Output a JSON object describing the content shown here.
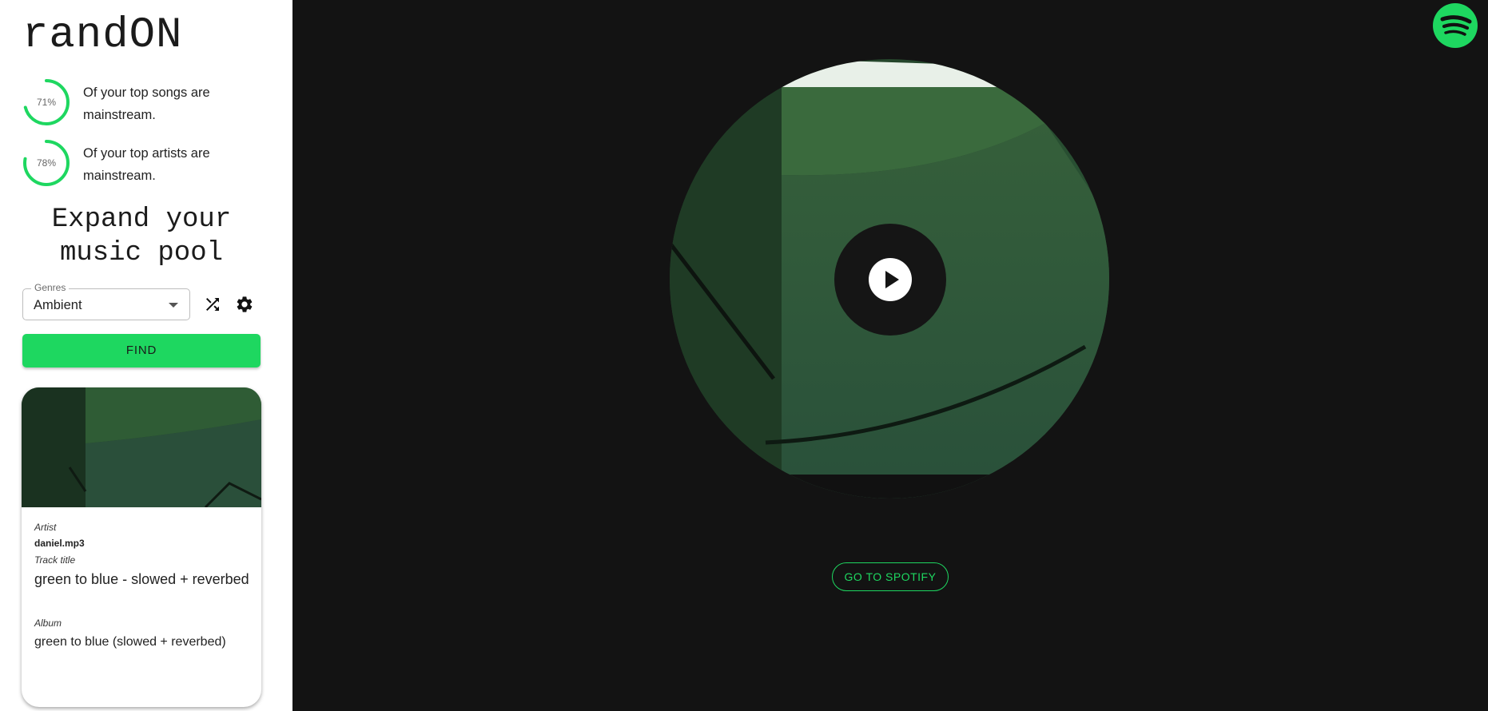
{
  "app": {
    "title": "randON"
  },
  "stats": [
    {
      "percent_label": "71%",
      "percent": 71,
      "text": "Of your top songs are mainstream."
    },
    {
      "percent_label": "78%",
      "percent": 78,
      "text": "Of your top artists are mainstream."
    }
  ],
  "expand_heading": "Expand your music pool",
  "genre_select": {
    "label": "Genres",
    "value": "Ambient"
  },
  "find_button": "FIND",
  "track_card": {
    "artist_label": "Artist",
    "artist": "daniel.mp3",
    "track_label": "Track title",
    "track": "green to blue - slowed + reverbed",
    "album_label": "Album",
    "album": "green to blue (slowed + reverbed)"
  },
  "spotify_button": "GO TO SPOTIFY",
  "icons": {
    "shuffle": "shuffle-icon",
    "settings": "gear-icon",
    "play": "play-icon",
    "spotify": "spotify-logo-icon"
  },
  "colors": {
    "accent": "#1ed760",
    "background": "#131313",
    "sidebar": "#ffffff"
  }
}
